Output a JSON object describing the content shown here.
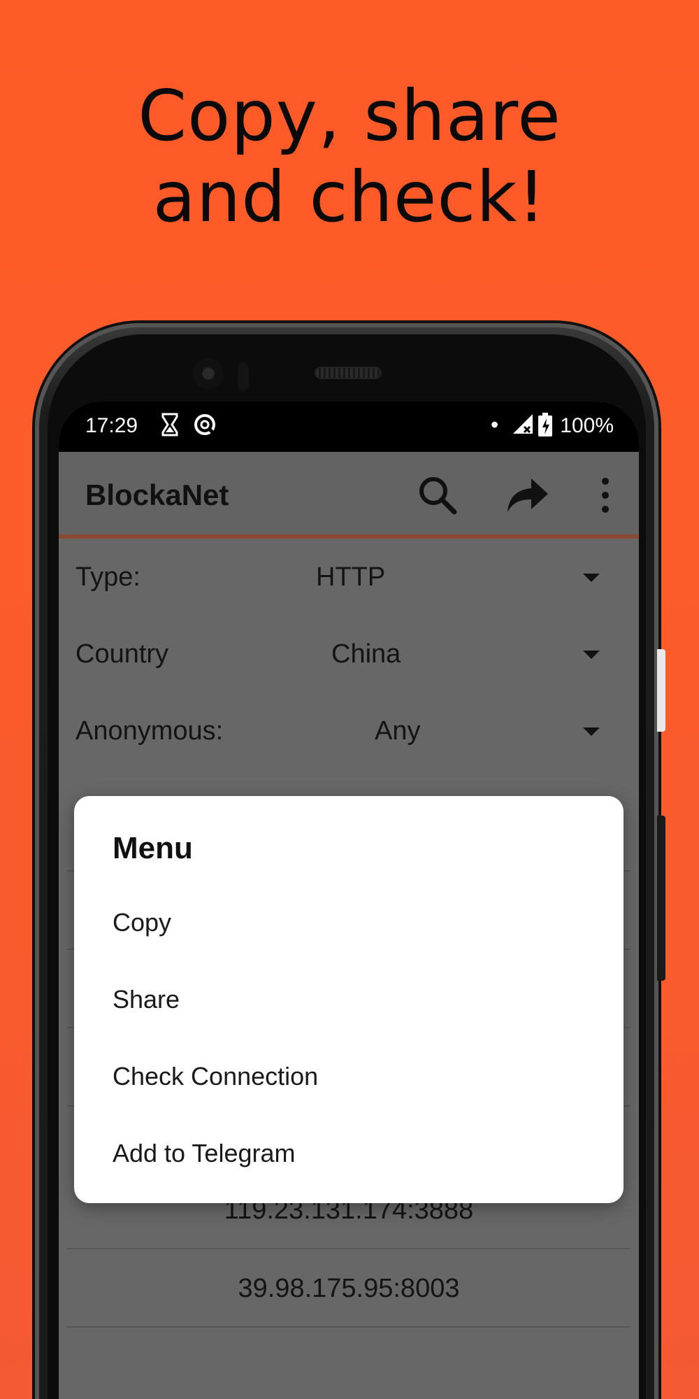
{
  "headline": {
    "line1": "Copy, share",
    "line2": "and check!"
  },
  "status_bar": {
    "time": "17:29",
    "battery": "100%",
    "dot": "•"
  },
  "app_bar": {
    "title": "BlockaNet"
  },
  "filters": [
    {
      "label": "Type:",
      "value": "HTTP"
    },
    {
      "label": "Country",
      "value": "China"
    },
    {
      "label": "Anonymous:",
      "value": "Any"
    }
  ],
  "proxies": [
    "119.23.131.174:3888",
    "39.98.175.95:8003"
  ],
  "menu": {
    "title": "Menu",
    "items": [
      "Copy",
      "Share",
      "Check Connection",
      "Add to Telegram"
    ]
  },
  "colors": {
    "background": "#ff5b27",
    "overlay": "#676767",
    "dialog": "#ffffff"
  },
  "icons": [
    "hourglass-icon",
    "sync-icon",
    "signal-icon",
    "battery-icon",
    "search-icon",
    "share-icon",
    "more-vert-icon",
    "dropdown-caret-icon"
  ]
}
